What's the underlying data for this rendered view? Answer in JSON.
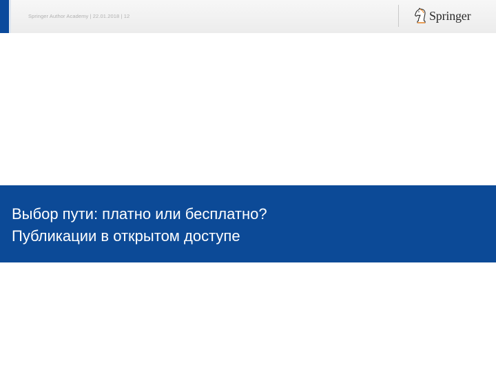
{
  "header": {
    "footer_text": "Springer Author Academy | 22.01.2018 | 12",
    "logo_text": "Springer",
    "accent_color": "#0b4a9c"
  },
  "title": {
    "line1": "Выбор пути: платно или бесплатно?",
    "line2": "Публикации в открытом доступе",
    "band_color": "#0c4a97"
  }
}
